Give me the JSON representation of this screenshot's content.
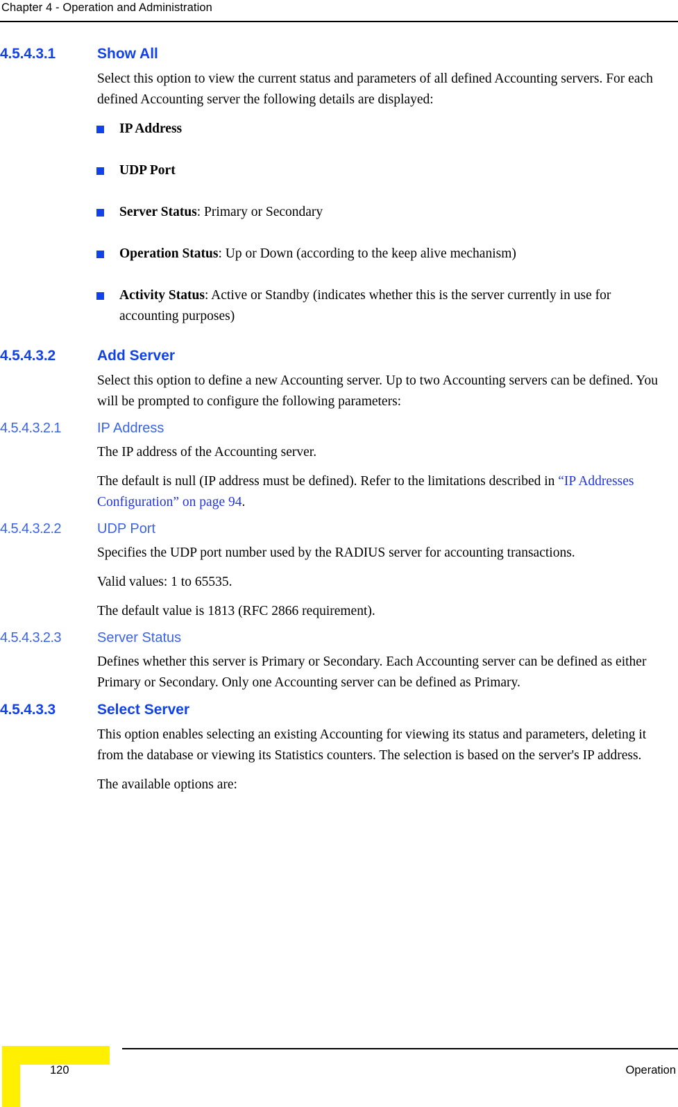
{
  "header": {
    "running_head": "Chapter 4 - Operation and Administration"
  },
  "sections": {
    "show_all": {
      "number": "4.5.4.3.1",
      "title": "Show All",
      "intro": "Select this option to view the current status and parameters of all defined Accounting servers. For each defined Accounting server the following details are displayed:",
      "bullets": [
        {
          "label": "IP Address",
          "rest": ""
        },
        {
          "label": "UDP Port",
          "rest": ""
        },
        {
          "label": "Server Status",
          "rest": ": Primary or Secondary"
        },
        {
          "label": "Operation Status",
          "rest": ": Up or Down (according to the keep alive mechanism)"
        },
        {
          "label": "Activity Status",
          "rest": ": Active or Standby (indicates whether this is the server currently in use for accounting purposes)"
        }
      ]
    },
    "add_server": {
      "number": "4.5.4.3.2",
      "title": "Add Server",
      "intro": "Select this option to define a new Accounting server. Up to two Accounting servers can be defined. You will be prompted to configure the following parameters:"
    },
    "ip_address": {
      "number": "4.5.4.3.2.1",
      "title": "IP Address",
      "para1": "The IP address of the Accounting server.",
      "para2_before": "The default is null (IP address must be defined). Refer to the limitations described in ",
      "para2_link": "“IP Addresses Configuration” on page 94",
      "para2_after": "."
    },
    "udp_port": {
      "number": "4.5.4.3.2.2",
      "title": "UDP Port",
      "para1": "Specifies the UDP port number used by the RADIUS server for accounting transactions.",
      "para2": "Valid values: 1 to 65535.",
      "para3": "The default value is 1813 (RFC 2866 requirement)."
    },
    "server_status": {
      "number": "4.5.4.3.2.3",
      "title": "Server Status",
      "para1": "Defines whether this server is Primary or Secondary. Each Accounting server can be defined as either Primary or Secondary. Only one Accounting server can be defined as Primary."
    },
    "select_server": {
      "number": "4.5.4.3.3",
      "title": "Select Server",
      "para1": "This option enables selecting an existing Accounting for viewing its status and parameters, deleting it from the database or viewing its Statistics counters. The selection is based on the server's IP address.",
      "para2": "The available options are:"
    }
  },
  "footer": {
    "page_number": "120",
    "section_name": "Operation"
  },
  "colors": {
    "heading_blue": "#1141e8",
    "subheading_blue": "#3a63e8",
    "bullet_blue": "#1141e8",
    "link_blue": "#2233dd",
    "tab_yellow": "#ffef00"
  }
}
